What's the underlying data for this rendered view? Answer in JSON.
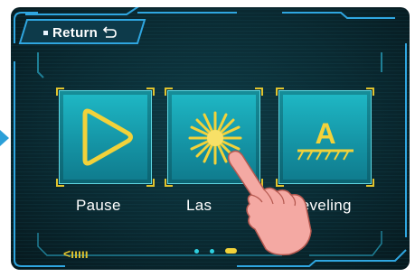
{
  "header": {
    "return_label": "Return",
    "return_icon": "return-arrow-icon"
  },
  "menu": {
    "items": [
      {
        "label": "Pause",
        "icon": "play-icon"
      },
      {
        "label": "Las",
        "icon": "laser-burst-icon"
      },
      {
        "label": "Leveling",
        "icon": "leveling-icon",
        "glyph": "A"
      }
    ]
  },
  "footer": {
    "back_icon": "chevron-back-icon",
    "back_glyph": "<ııııı"
  },
  "pager": {
    "total": 3,
    "current": 3
  },
  "colors": {
    "accent_cyan": "#1fb9c6",
    "icon_yellow": "#f2d23a",
    "frame_blue": "#2fa6e0",
    "background": "#0a2a32"
  }
}
